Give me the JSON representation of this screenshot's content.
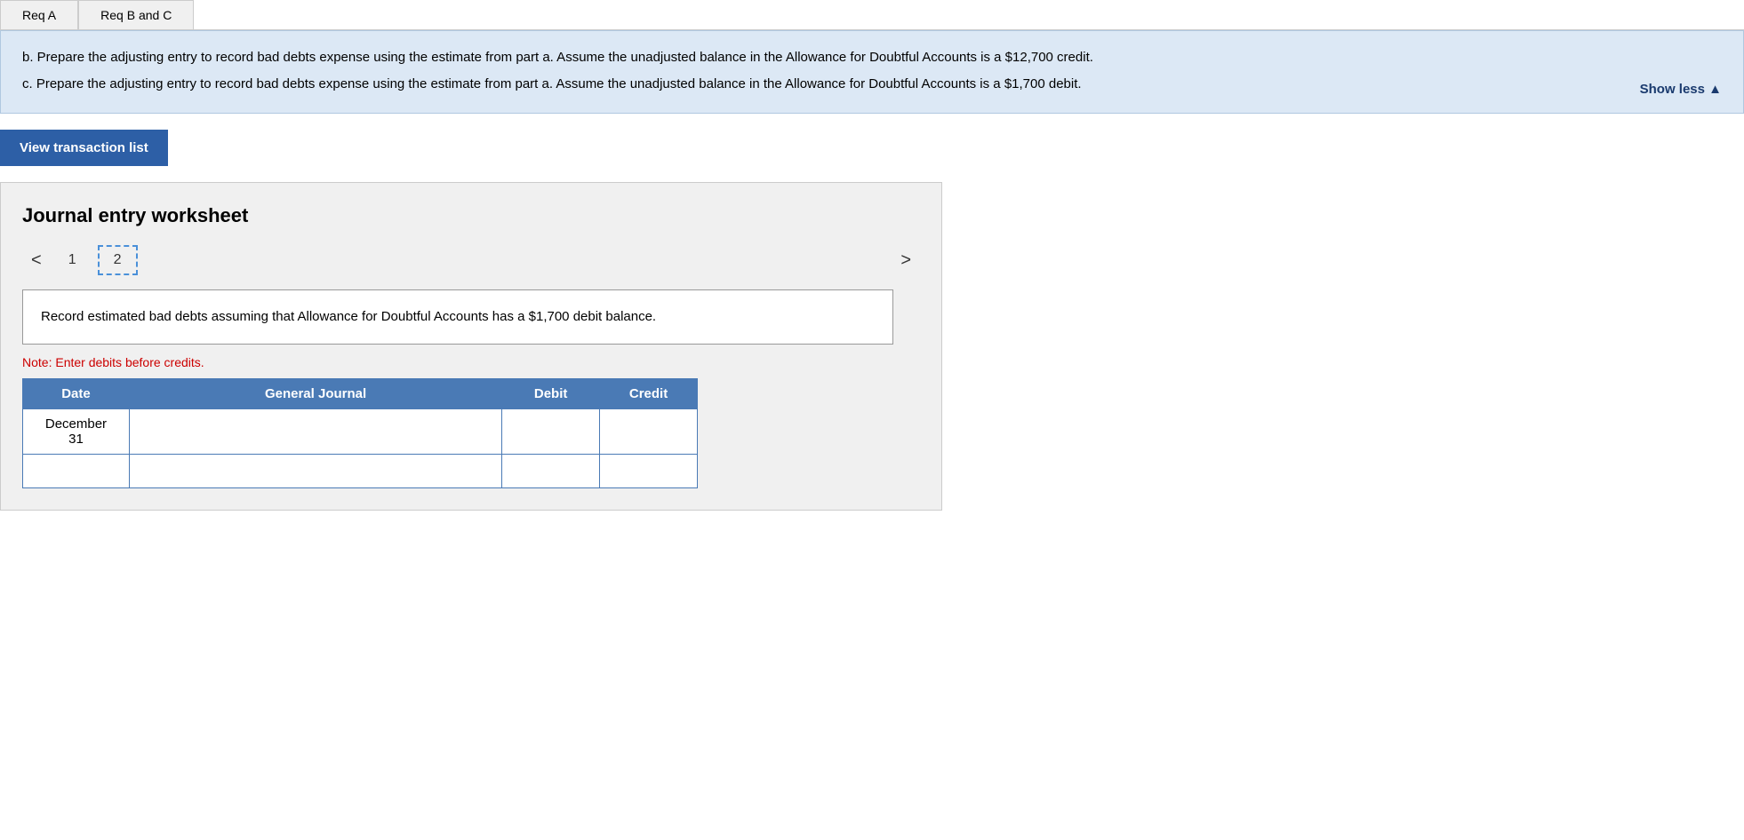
{
  "tabs": [
    {
      "label": "Req A",
      "active": false
    },
    {
      "label": "Req B and C",
      "active": false
    }
  ],
  "instructions": {
    "part_b": "b. Prepare the adjusting entry to record bad debts expense using the estimate from part a. Assume the unadjusted balance in the Allowance for Doubtful Accounts is a $12,700 credit.",
    "part_c": "c. Prepare the adjusting entry to record bad debts expense using the estimate from part a. Assume the unadjusted balance in the Allowance for Doubtful Accounts is a $1,700 debit.",
    "show_less": "Show less"
  },
  "view_transaction_btn": "View transaction list",
  "worksheet": {
    "title": "Journal entry worksheet",
    "pages": [
      {
        "num": "1",
        "active": false
      },
      {
        "num": "2",
        "active": true
      }
    ],
    "nav_left": "<",
    "nav_right": ">",
    "description": "Record estimated bad debts assuming that Allowance for Doubtful Accounts has a $1,700 debit balance.",
    "note": "Note: Enter debits before credits.",
    "table": {
      "headers": [
        "Date",
        "General Journal",
        "Debit",
        "Credit"
      ],
      "rows": [
        {
          "date": "December\n31",
          "general_journal": "",
          "debit": "",
          "credit": ""
        },
        {
          "date": "",
          "general_journal": "",
          "debit": "",
          "credit": ""
        }
      ]
    }
  }
}
